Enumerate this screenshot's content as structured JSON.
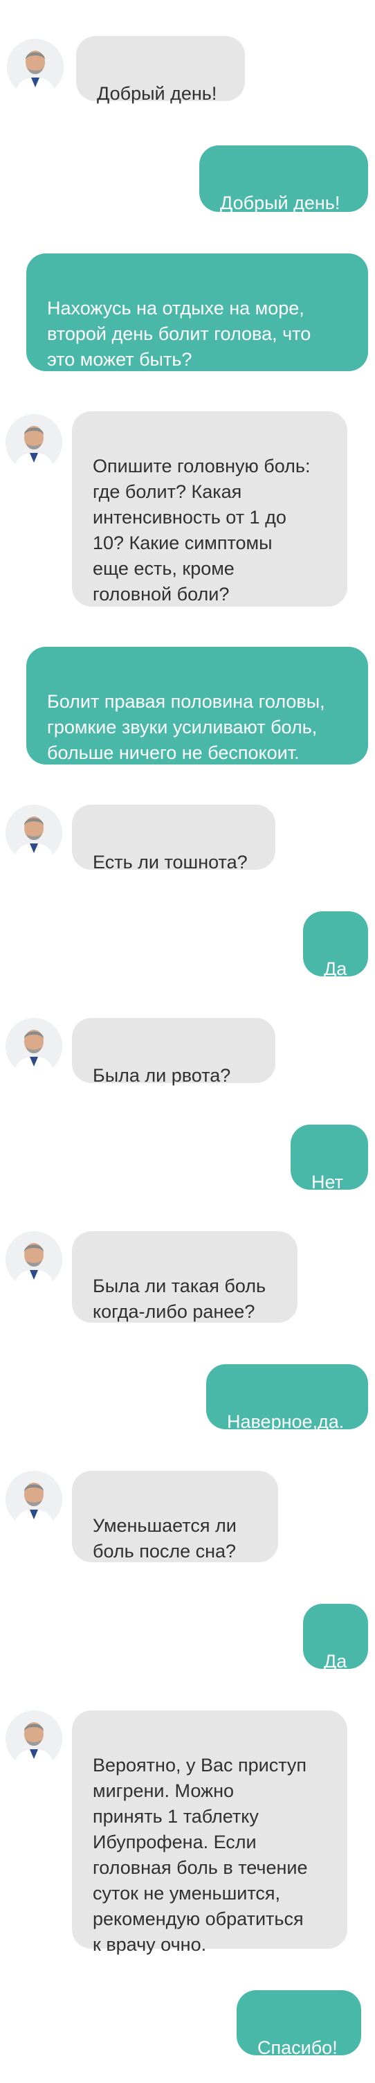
{
  "chat": {
    "messages": [
      {
        "from": "doctor",
        "text": "Добрый день!"
      },
      {
        "from": "user",
        "text": "Добрый день!"
      },
      {
        "from": "user",
        "text": "Нахожусь на отдыхе на море,\nвторой день болит голова, что\nэто может быть?"
      },
      {
        "from": "doctor",
        "text": "Опишите головную боль:\nгде болит? Какая\nинтенсивность от 1 до\n10? Какие симптомы\nеще есть, кроме\nголовной боли?"
      },
      {
        "from": "user",
        "text": "Болит правая половина головы,\nгромкие звуки усиливают боль,\nбольше ничего не беспокоит."
      },
      {
        "from": "doctor",
        "text": "Есть ли тошнота?"
      },
      {
        "from": "user",
        "text": "Да"
      },
      {
        "from": "doctor",
        "text": "Была ли рвота?"
      },
      {
        "from": "user",
        "text": "Нет"
      },
      {
        "from": "doctor",
        "text": "Была ли такая боль\nкогда-либо ранее?"
      },
      {
        "from": "user",
        "text": "Наверное,да."
      },
      {
        "from": "doctor",
        "text": "Уменьшается ли\nболь после сна?"
      },
      {
        "from": "user",
        "text": "Да"
      },
      {
        "from": "doctor",
        "text": "Вероятно, у Вас приступ\nмигрени. Можно\nпринять 1 таблетку\nИбупрофена. Если\nголовная боль в течение\nсуток не уменьшится,\nрекомендую обратиться\nк врачу очно."
      },
      {
        "from": "user",
        "text": "Спасибо!"
      }
    ]
  },
  "colors": {
    "incoming_bubble": "#e6e6e6",
    "outgoing_bubble": "#49b8a8",
    "outgoing_text": "#ffffff",
    "incoming_text": "#303030"
  },
  "icons": {
    "avatar": "doctor-avatar-icon"
  }
}
